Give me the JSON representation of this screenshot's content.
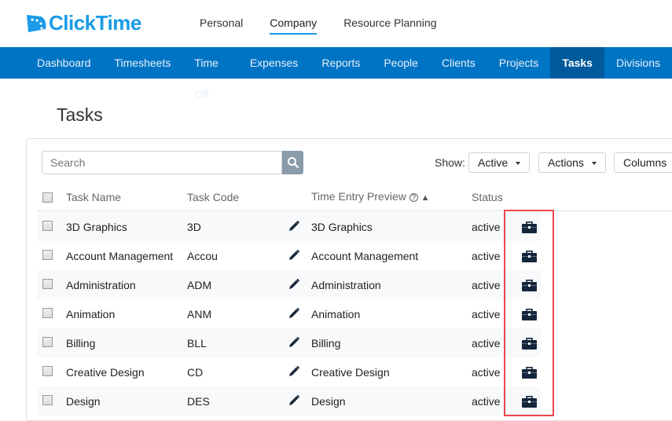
{
  "app": {
    "logo_text": "ClickTime",
    "brand_color": "#1a9be8"
  },
  "top_nav": [
    "Personal",
    "Company",
    "Resource Planning"
  ],
  "top_nav_active": "Company",
  "main_nav": [
    "Dashboard",
    "Timesheets",
    "Time Off",
    "Expenses",
    "Reports",
    "People",
    "Clients",
    "Projects",
    "Tasks",
    "Divisions"
  ],
  "main_nav_active": "Tasks",
  "page_title": "Tasks",
  "search": {
    "placeholder": "Search"
  },
  "toolbar": {
    "show_label": "Show:",
    "show_value": "Active",
    "actions_label": "Actions",
    "columns_label": "Columns"
  },
  "table": {
    "headers": {
      "name": "Task Name",
      "code": "Task Code",
      "preview": "Time Entry Preview",
      "status": "Status"
    },
    "rows": [
      {
        "name": "3D Graphics",
        "code": "3D",
        "preview": "3D Graphics",
        "status": "active"
      },
      {
        "name": "Account Management",
        "code": "Accou",
        "preview": "Account Management",
        "status": "active"
      },
      {
        "name": "Administration",
        "code": "ADM",
        "preview": "Administration",
        "status": "active"
      },
      {
        "name": "Animation",
        "code": "ANM",
        "preview": "Animation",
        "status": "active"
      },
      {
        "name": "Billing",
        "code": "BLL",
        "preview": "Billing",
        "status": "active"
      },
      {
        "name": "Creative Design",
        "code": "CD",
        "preview": "Creative Design",
        "status": "active"
      },
      {
        "name": "Design",
        "code": "DES",
        "preview": "Design",
        "status": "active"
      }
    ]
  },
  "highlight_color": "#e8474c"
}
